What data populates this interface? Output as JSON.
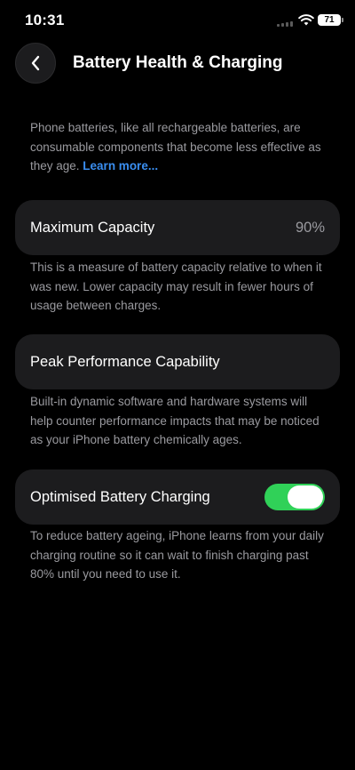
{
  "status_bar": {
    "time": "10:31",
    "battery_level": "71",
    "icons": [
      "signal-icon",
      "wifi-icon",
      "battery-icon"
    ]
  },
  "header": {
    "back_icon": "chevron-left-icon",
    "title": "Battery Health & Charging"
  },
  "intro": {
    "text": "Phone batteries, like all rechargeable batteries, are consumable components that become less effective as they age. ",
    "link_label": "Learn more..."
  },
  "maximum_capacity": {
    "label": "Maximum Capacity",
    "value": "90%",
    "footnote": "This is a measure of battery capacity relative to when it was new. Lower capacity may result in fewer hours of usage between charges."
  },
  "peak_performance": {
    "label": "Peak Performance Capability",
    "footnote": "Built-in dynamic software and hardware systems will help counter performance impacts that may be noticed as your iPhone battery chemically ages."
  },
  "optimised_charging": {
    "label": "Optimised Battery Charging",
    "enabled": true,
    "footnote": "To reduce battery ageing, iPhone learns from your daily charging routine so it can wait to finish charging past 80% until you need to use it."
  },
  "colors": {
    "background": "#000000",
    "card": "#1c1c1e",
    "secondary_text": "#9a9a9f",
    "link": "#3a8ef0",
    "toggle_on": "#30d158"
  }
}
